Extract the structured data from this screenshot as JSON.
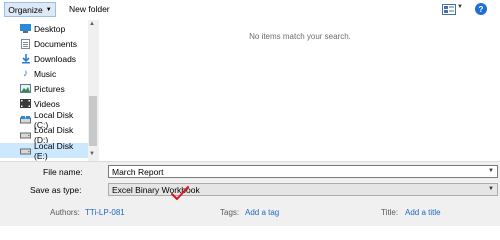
{
  "toolbar": {
    "organize_label": "Organize",
    "new_folder_label": "New folder",
    "help_label": "?"
  },
  "nav": {
    "items": [
      {
        "label": "Desktop",
        "icon": "desktop-icon"
      },
      {
        "label": "Documents",
        "icon": "documents-icon"
      },
      {
        "label": "Downloads",
        "icon": "downloads-icon"
      },
      {
        "label": "Music",
        "icon": "music-icon"
      },
      {
        "label": "Pictures",
        "icon": "pictures-icon"
      },
      {
        "label": "Videos",
        "icon": "videos-icon"
      },
      {
        "label": "Local Disk (C:)",
        "icon": "drive-icon"
      },
      {
        "label": "Local Disk (D:)",
        "icon": "drive-icon"
      },
      {
        "label": "Local Disk (E:)",
        "icon": "drive-icon",
        "selected": true
      }
    ]
  },
  "content": {
    "empty_message": "No items match your search."
  },
  "form": {
    "file_name_label": "File name:",
    "file_name_value": "March Report",
    "save_as_type_label": "Save as type:",
    "save_as_type_value": "Excel Binary Workbook",
    "authors_label": "Authors:",
    "authors_value": "TTi-LP-081",
    "tags_label": "Tags:",
    "tags_value": "Add a tag",
    "title_label": "Title:",
    "title_value": "Add a title"
  },
  "colors": {
    "accent": "#1f6fd6",
    "selection": "#cce8ff",
    "link": "#2068c8",
    "check_mark": "#e0141e"
  }
}
